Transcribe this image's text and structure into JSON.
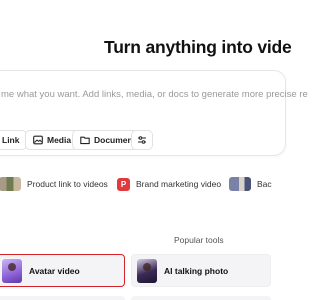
{
  "hero": {
    "title": "Turn anything into vide"
  },
  "prompt": {
    "placeholder": "me what you want. Add links, media, or docs to generate more precise re"
  },
  "chips": [
    {
      "label": "Link",
      "icon": "link-icon"
    },
    {
      "label": "Media",
      "icon": "image-icon"
    },
    {
      "label": "Document",
      "icon": "folder-icon"
    },
    {
      "label": "",
      "icon": "settings-sliders-icon"
    }
  ],
  "suggestions": [
    {
      "label": "Product link to videos",
      "icon": "product-thumbnail"
    },
    {
      "label": "Brand marketing video",
      "icon": "p-badge-icon",
      "badge": "P"
    },
    {
      "label": "Bac",
      "icon": "scene-thumbnail"
    }
  ],
  "popular": {
    "label": "Popular tools",
    "tools": [
      {
        "label": "Avatar video",
        "selected": true
      },
      {
        "label": "AI talking photo",
        "selected": false
      }
    ]
  },
  "colors": {
    "accent_selected_border": "#d8232a",
    "badge_red": "#e0393e",
    "card_bg": "#f4f4f6"
  }
}
